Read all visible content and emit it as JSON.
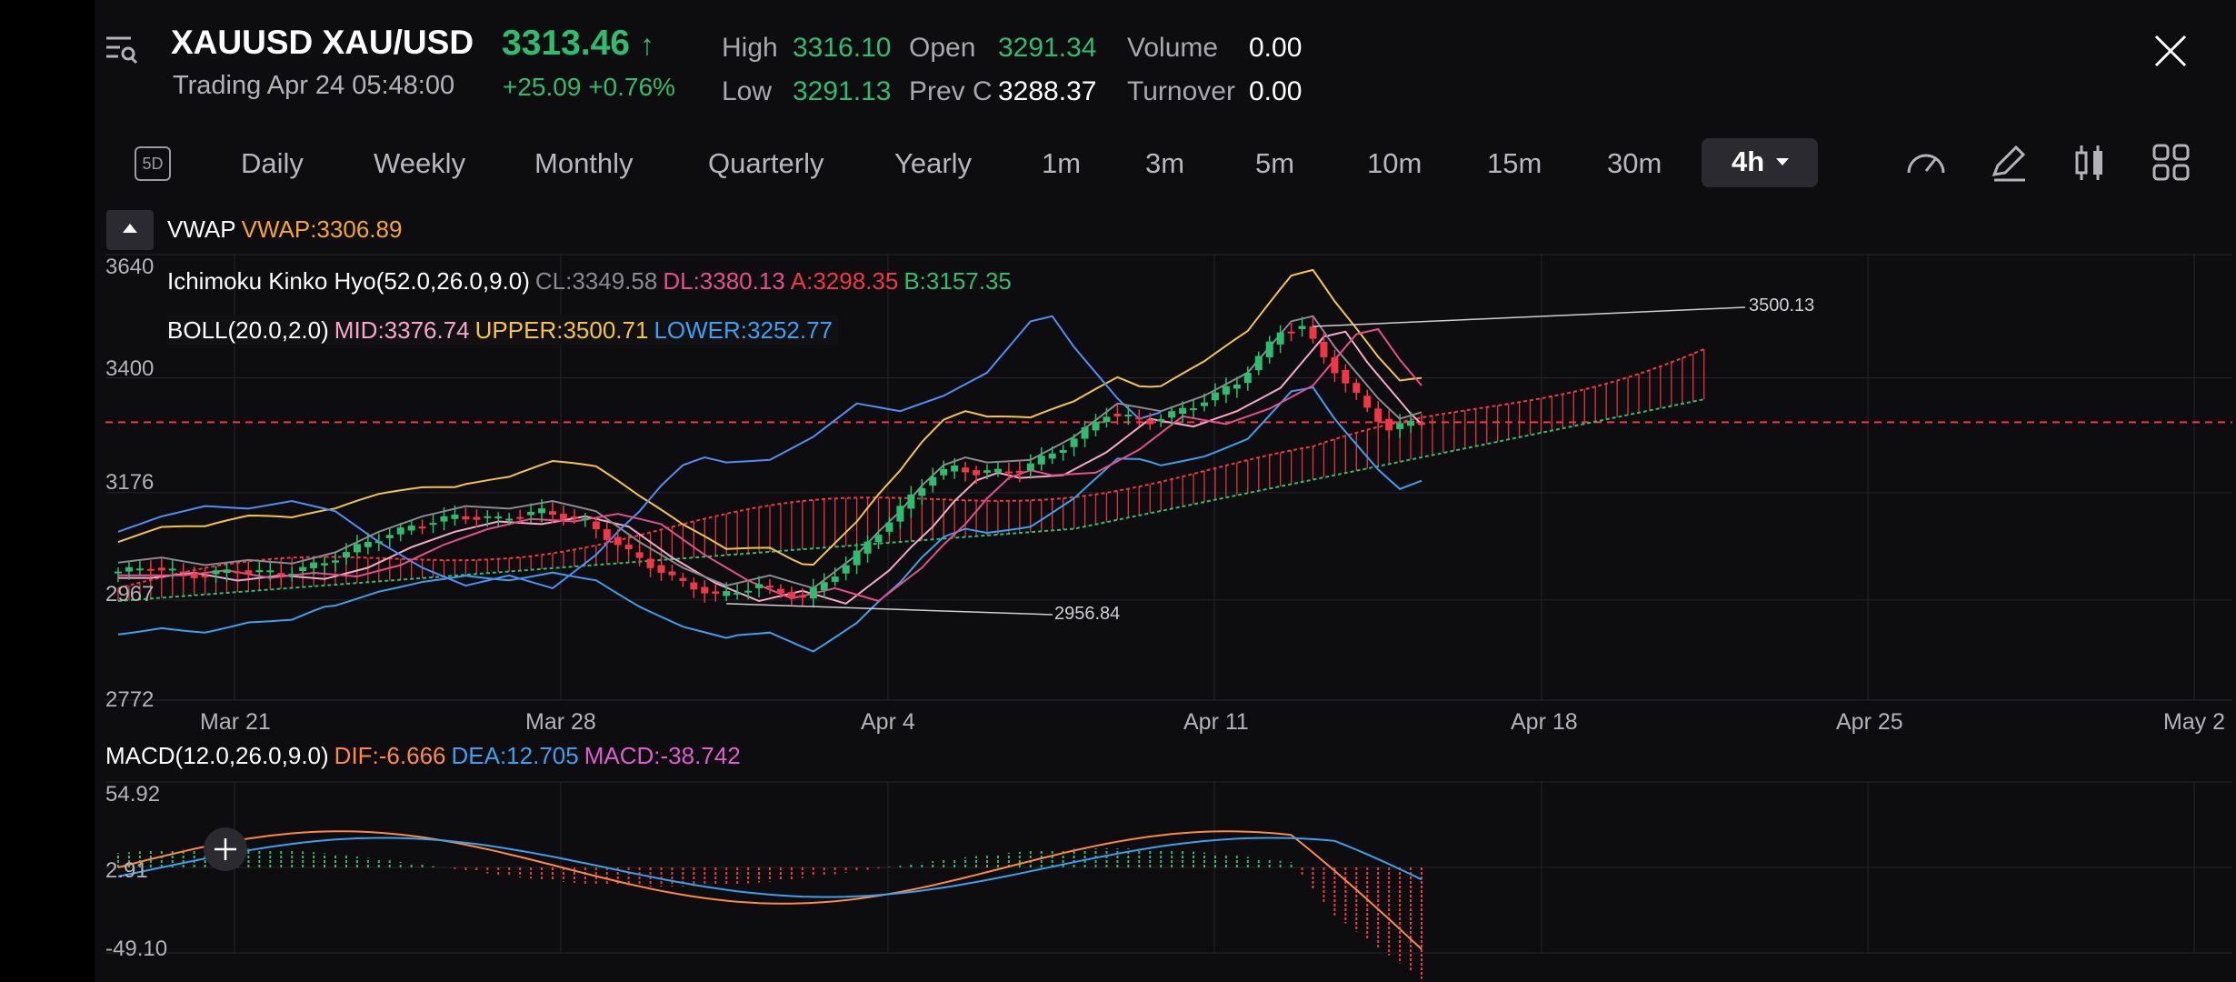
{
  "header": {
    "symbol": "XAUUSD",
    "pair": "XAU/USD",
    "status": "Trading",
    "datetime": "Apr 24 05:48:00",
    "price": "3313.46",
    "price_arrow": "↑",
    "change": "+25.09",
    "change_pct": "+0.76%",
    "stats": [
      {
        "label": "High",
        "value": "3316.10"
      },
      {
        "label": "Low",
        "value": "3291.13"
      },
      {
        "label": "Open",
        "value": "3291.34"
      },
      {
        "label": "Prev C",
        "value": "3288.37"
      },
      {
        "label": "Volume",
        "value": "0.00"
      },
      {
        "label": "Turnover",
        "value": "0.00"
      }
    ]
  },
  "timeframes": {
    "badge": "5D",
    "items": [
      "Daily",
      "Weekly",
      "Monthly",
      "Quarterly",
      "Yearly",
      "1m",
      "3m",
      "5m",
      "10m",
      "15m",
      "30m"
    ],
    "selected": "4h"
  },
  "icons": [
    "menu-search-icon",
    "close-icon",
    "speedometer-icon",
    "pen-icon",
    "candlestick-icon",
    "grid-icon",
    "collapse-arrow-icon",
    "crosshair-icon"
  ],
  "indicators": {
    "vwap": {
      "name": "VWAP",
      "value": "VWAP:3306.89"
    },
    "ichimoku": {
      "name": "Ichimoku Kinko Hyo(52.0,26.0,9.0)",
      "cl": "CL:3349.58",
      "dl": "DL:3380.13",
      "a": "A:3298.35",
      "b": "B:3157.35"
    },
    "boll": {
      "name": "BOLL(20.0,2.0)",
      "mid": "MID:3376.74",
      "upper": "UPPER:3500.71",
      "lower": "LOWER:3252.77"
    },
    "macd": {
      "name": "MACD(12.0,26.0,9.0)",
      "dif": "DIF:-6.666",
      "dea": "DEA:12.705",
      "macd": "MACD:-38.742"
    }
  },
  "colors": {
    "up": "#2ebd6e",
    "down": "#f23645",
    "vwap": "#f5a623",
    "cl": "#8a8a8f",
    "dl": "#e84d8a",
    "a": "#f23645",
    "b": "#2ebd6e",
    "mid": "#f7a8c8",
    "upper": "#f5c542",
    "lower": "#3aa0f0",
    "dif": "#ff8a3d",
    "dea": "#3aa0f0",
    "macd_hist": "#e05cd0"
  },
  "chart_data": {
    "type": "line",
    "title": "XAUUSD XAU/USD 4h",
    "y_ticks": [
      "3640",
      "3400",
      "3176",
      "2967",
      "2772"
    ],
    "x_ticks": [
      "Mar 21",
      "Mar 28",
      "Apr 4",
      "Apr 11",
      "Apr 18",
      "Apr 25",
      "May 2"
    ],
    "ylim": [
      2772,
      3640
    ],
    "high_marker": "3500.13",
    "low_marker": "2956.84",
    "current_price_line": 3313.46,
    "macd_y_ticks": [
      "54.92",
      "2.91",
      "-49.10"
    ],
    "macd_ylim": [
      -49.1,
      54.92
    ],
    "macd_zero": 2.91,
    "series": [
      {
        "name": "Price",
        "x": [
          0,
          2,
          4,
          6,
          8,
          10,
          12,
          14,
          16,
          18,
          20,
          22,
          24,
          26,
          28,
          30,
          32,
          34,
          35,
          36,
          37,
          38,
          39,
          40,
          42,
          44,
          46,
          48,
          50,
          52
        ],
        "values": [
          3020,
          3030,
          3015,
          3025,
          3018,
          3040,
          3080,
          3110,
          3130,
          3125,
          3140,
          3120,
          3060,
          3010,
          2975,
          2995,
          2970,
          3035,
          3080,
          3120,
          3170,
          3210,
          3225,
          3215,
          3220,
          3265,
          3330,
          3315,
          3345,
          3390
        ]
      },
      {
        "name": "Price2",
        "x": [
          52,
          53,
          54,
          55,
          56,
          57,
          58,
          59,
          60
        ],
        "values": [
          3390,
          3440,
          3490,
          3500,
          3440,
          3390,
          3340,
          3300,
          3313
        ]
      }
    ]
  }
}
